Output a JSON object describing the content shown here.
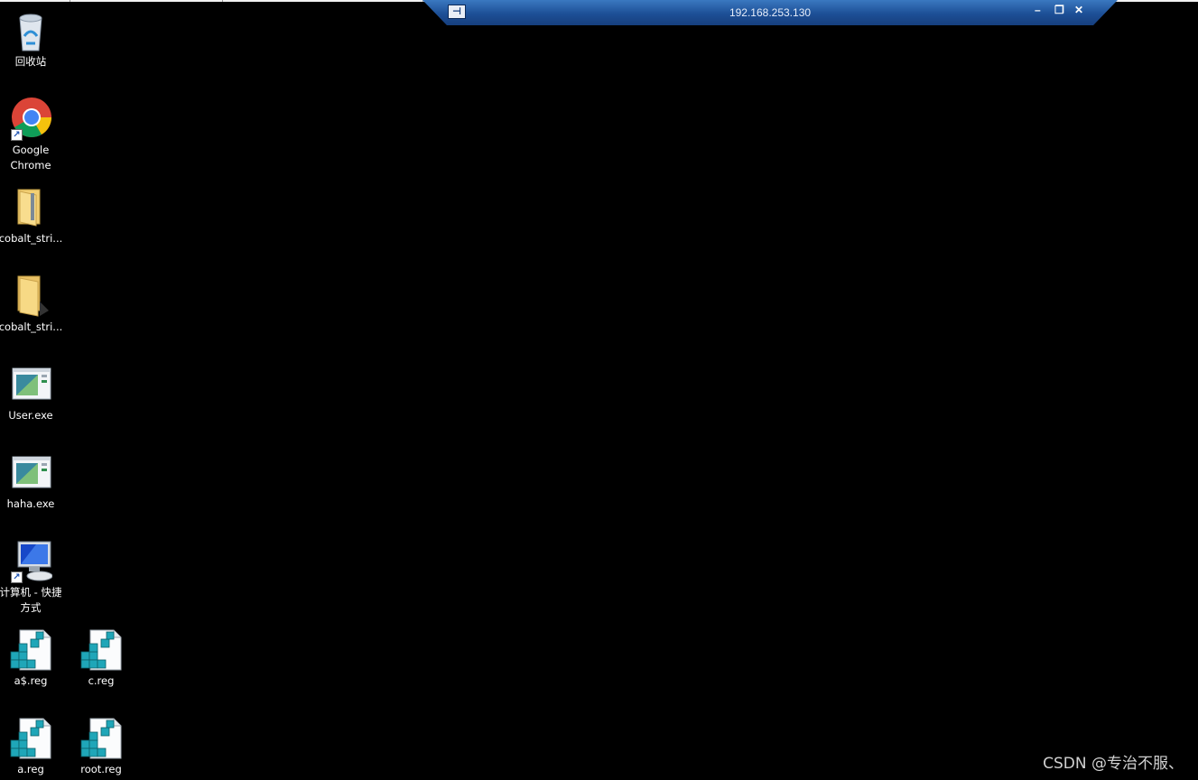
{
  "rdp_bar": {
    "title": "192.168.253.130",
    "pin_glyph": "⊣",
    "minimize_glyph": "–",
    "restore_glyph": "❐",
    "close_glyph": "✕"
  },
  "desktop_icons": [
    {
      "label": "回收站",
      "icon": "recycle-bin-icon"
    },
    {
      "label": "Google\nChrome",
      "icon": "chrome-icon"
    },
    {
      "label": "cobalt_stri...",
      "icon": "zip-folder-icon"
    },
    {
      "label": "cobalt_stri...",
      "icon": "folder-icon"
    },
    {
      "label": "User.exe",
      "icon": "exe-icon"
    },
    {
      "label": "haha.exe",
      "icon": "exe-icon"
    },
    {
      "label": "计算机 - 快捷\n方式",
      "icon": "computer-icon"
    },
    {
      "label": "a$.reg",
      "icon": "registry-file-icon"
    },
    {
      "label": "c.reg",
      "icon": "registry-file-icon"
    },
    {
      "label": "a.reg",
      "icon": "registry-file-icon"
    },
    {
      "label": "root.reg",
      "icon": "registry-file-icon"
    }
  ],
  "watermark": "CSDN @专治不服、",
  "colors": {
    "desktop": "#000000",
    "rdp_bar": "#1d4f96"
  }
}
